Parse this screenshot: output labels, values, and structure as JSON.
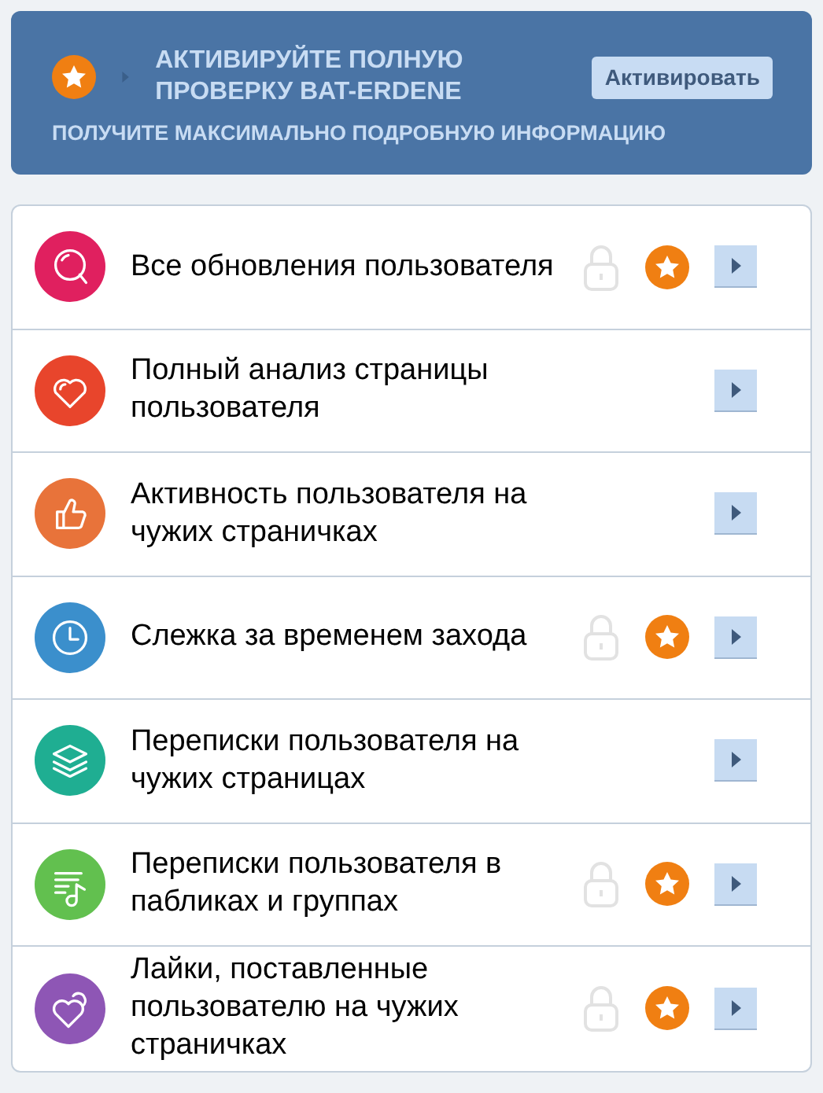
{
  "banner": {
    "title": "АКТИВИРУЙТЕ ПОЛНУЮ ПРОВЕРКУ BAT-ERDENE",
    "button": "Активировать",
    "subtitle": "ПОЛУЧИТЕ МАКСИМАЛЬНО ПОДРОБНУЮ ИНФОРМАЦИЮ"
  },
  "items": [
    {
      "kind": "search",
      "color": "#e0205f",
      "title": "Все обновления пользователя",
      "locked": true
    },
    {
      "kind": "heart",
      "color": "#e8452c",
      "title": "Полный анализ страницы пользователя",
      "locked": false
    },
    {
      "kind": "thumb",
      "color": "#e8733a",
      "title": "Активность пользователя на чужих страничках",
      "locked": false
    },
    {
      "kind": "clock",
      "color": "#3b8fcc",
      "title": "Слежка за временем захода",
      "locked": true
    },
    {
      "kind": "layers",
      "color": "#1fae92",
      "title": "Переписки пользователя на чужих страницах",
      "locked": false
    },
    {
      "kind": "music",
      "color": "#62c04f",
      "title": "Переписки пользователя в пабликах и группах",
      "locked": true
    },
    {
      "kind": "hearts",
      "color": "#8e56b5",
      "title": "Лайки, поставленные пользователю на чужих страничках",
      "locked": true
    }
  ]
}
